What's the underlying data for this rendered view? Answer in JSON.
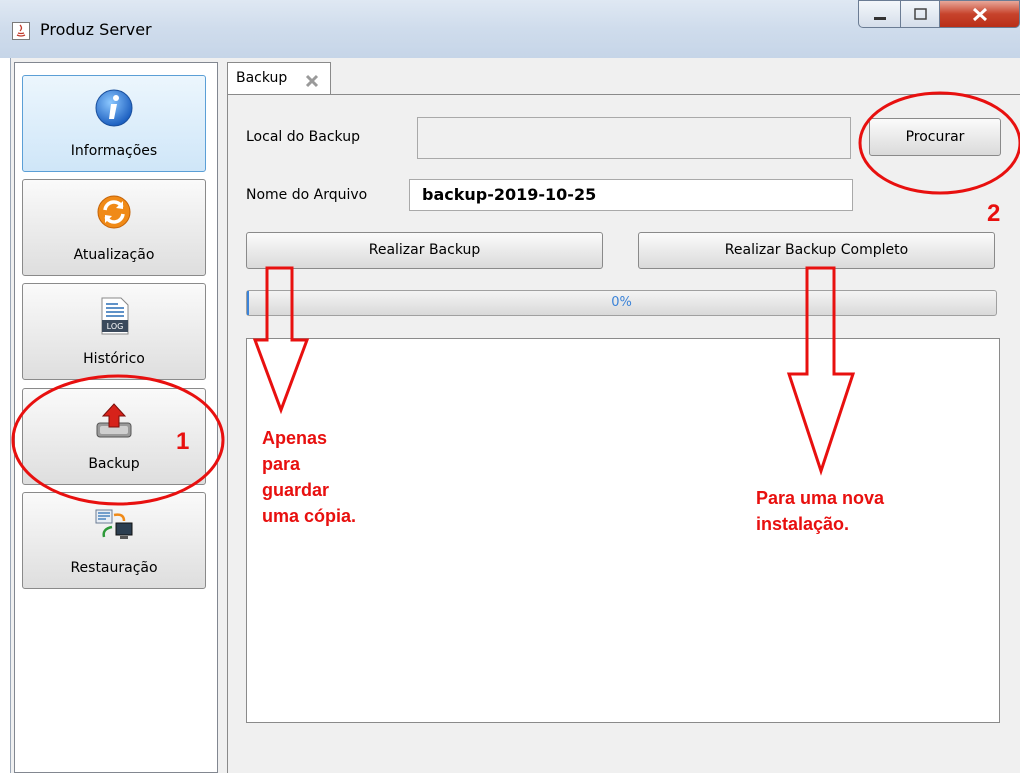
{
  "window": {
    "title": "Produz Server"
  },
  "sidebar": {
    "items": [
      {
        "label": "Informações",
        "icon": "info-icon",
        "active": true
      },
      {
        "label": "Atualização",
        "icon": "refresh-icon",
        "active": false
      },
      {
        "label": "Histórico",
        "icon": "log-icon",
        "active": false
      },
      {
        "label": "Backup",
        "icon": "backup-icon",
        "active": false
      },
      {
        "label": "Restauração",
        "icon": "restore-icon",
        "active": false
      }
    ]
  },
  "tab": {
    "label": "Backup",
    "close_icon": "close-icon"
  },
  "form": {
    "local_label": "Local do Backup",
    "local_value": "",
    "browse_button": "Procurar",
    "file_label": "Nome do Arquivo",
    "file_value": "backup-2019-10-25",
    "backup_button": "Realizar Backup",
    "full_backup_button": "Realizar Backup Completo",
    "progress": {
      "value": 0,
      "text": "0%"
    }
  },
  "annotations": {
    "marker1": "1",
    "marker2": "2",
    "note_left": [
      "Apenas",
      "para",
      "guardar",
      "uma cópia."
    ],
    "note_right": [
      "Para uma nova",
      "instalação."
    ],
    "color": "#e8100f"
  },
  "colors": {
    "accent": "#3b83d8",
    "annotation": "#e8100f",
    "titlebar": "#cfdcec"
  }
}
